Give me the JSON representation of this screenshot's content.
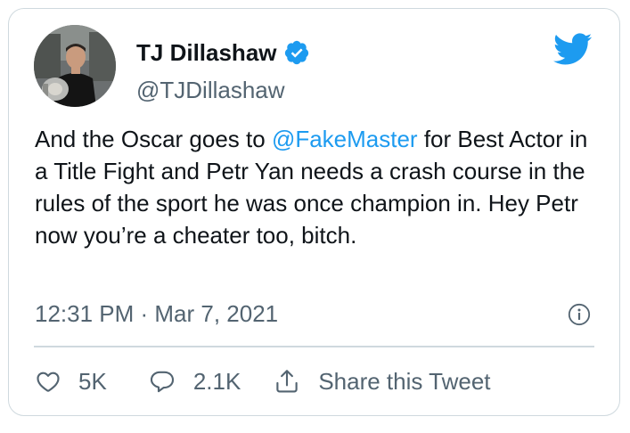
{
  "author": {
    "name": "TJ Dillashaw",
    "handle": "@TJDillashaw",
    "verified": true
  },
  "tweet": {
    "text_before_mention": "And the Oscar goes to ",
    "mention": "@FakeMaster",
    "text_after_mention": " for Best Actor in a Title Fight and Petr Yan needs a crash course in the rules of the sport he was once champion in. Hey Petr now you’re a cheater too, bitch.",
    "timestamp": "12:31 PM · Mar 7, 2021"
  },
  "actions": {
    "like_count": "5K",
    "reply_count": "2.1K",
    "share_label": "Share this Tweet"
  },
  "icons": {
    "brand": "twitter-bird-icon",
    "verified": "verified-badge-icon",
    "info": "info-icon",
    "like": "heart-icon",
    "reply": "speech-bubble-icon",
    "share": "share-upload-icon"
  },
  "colors": {
    "brand_blue": "#1d9bf0",
    "text_primary": "#0f1419",
    "text_secondary": "#536471",
    "border": "#cfd9de"
  }
}
